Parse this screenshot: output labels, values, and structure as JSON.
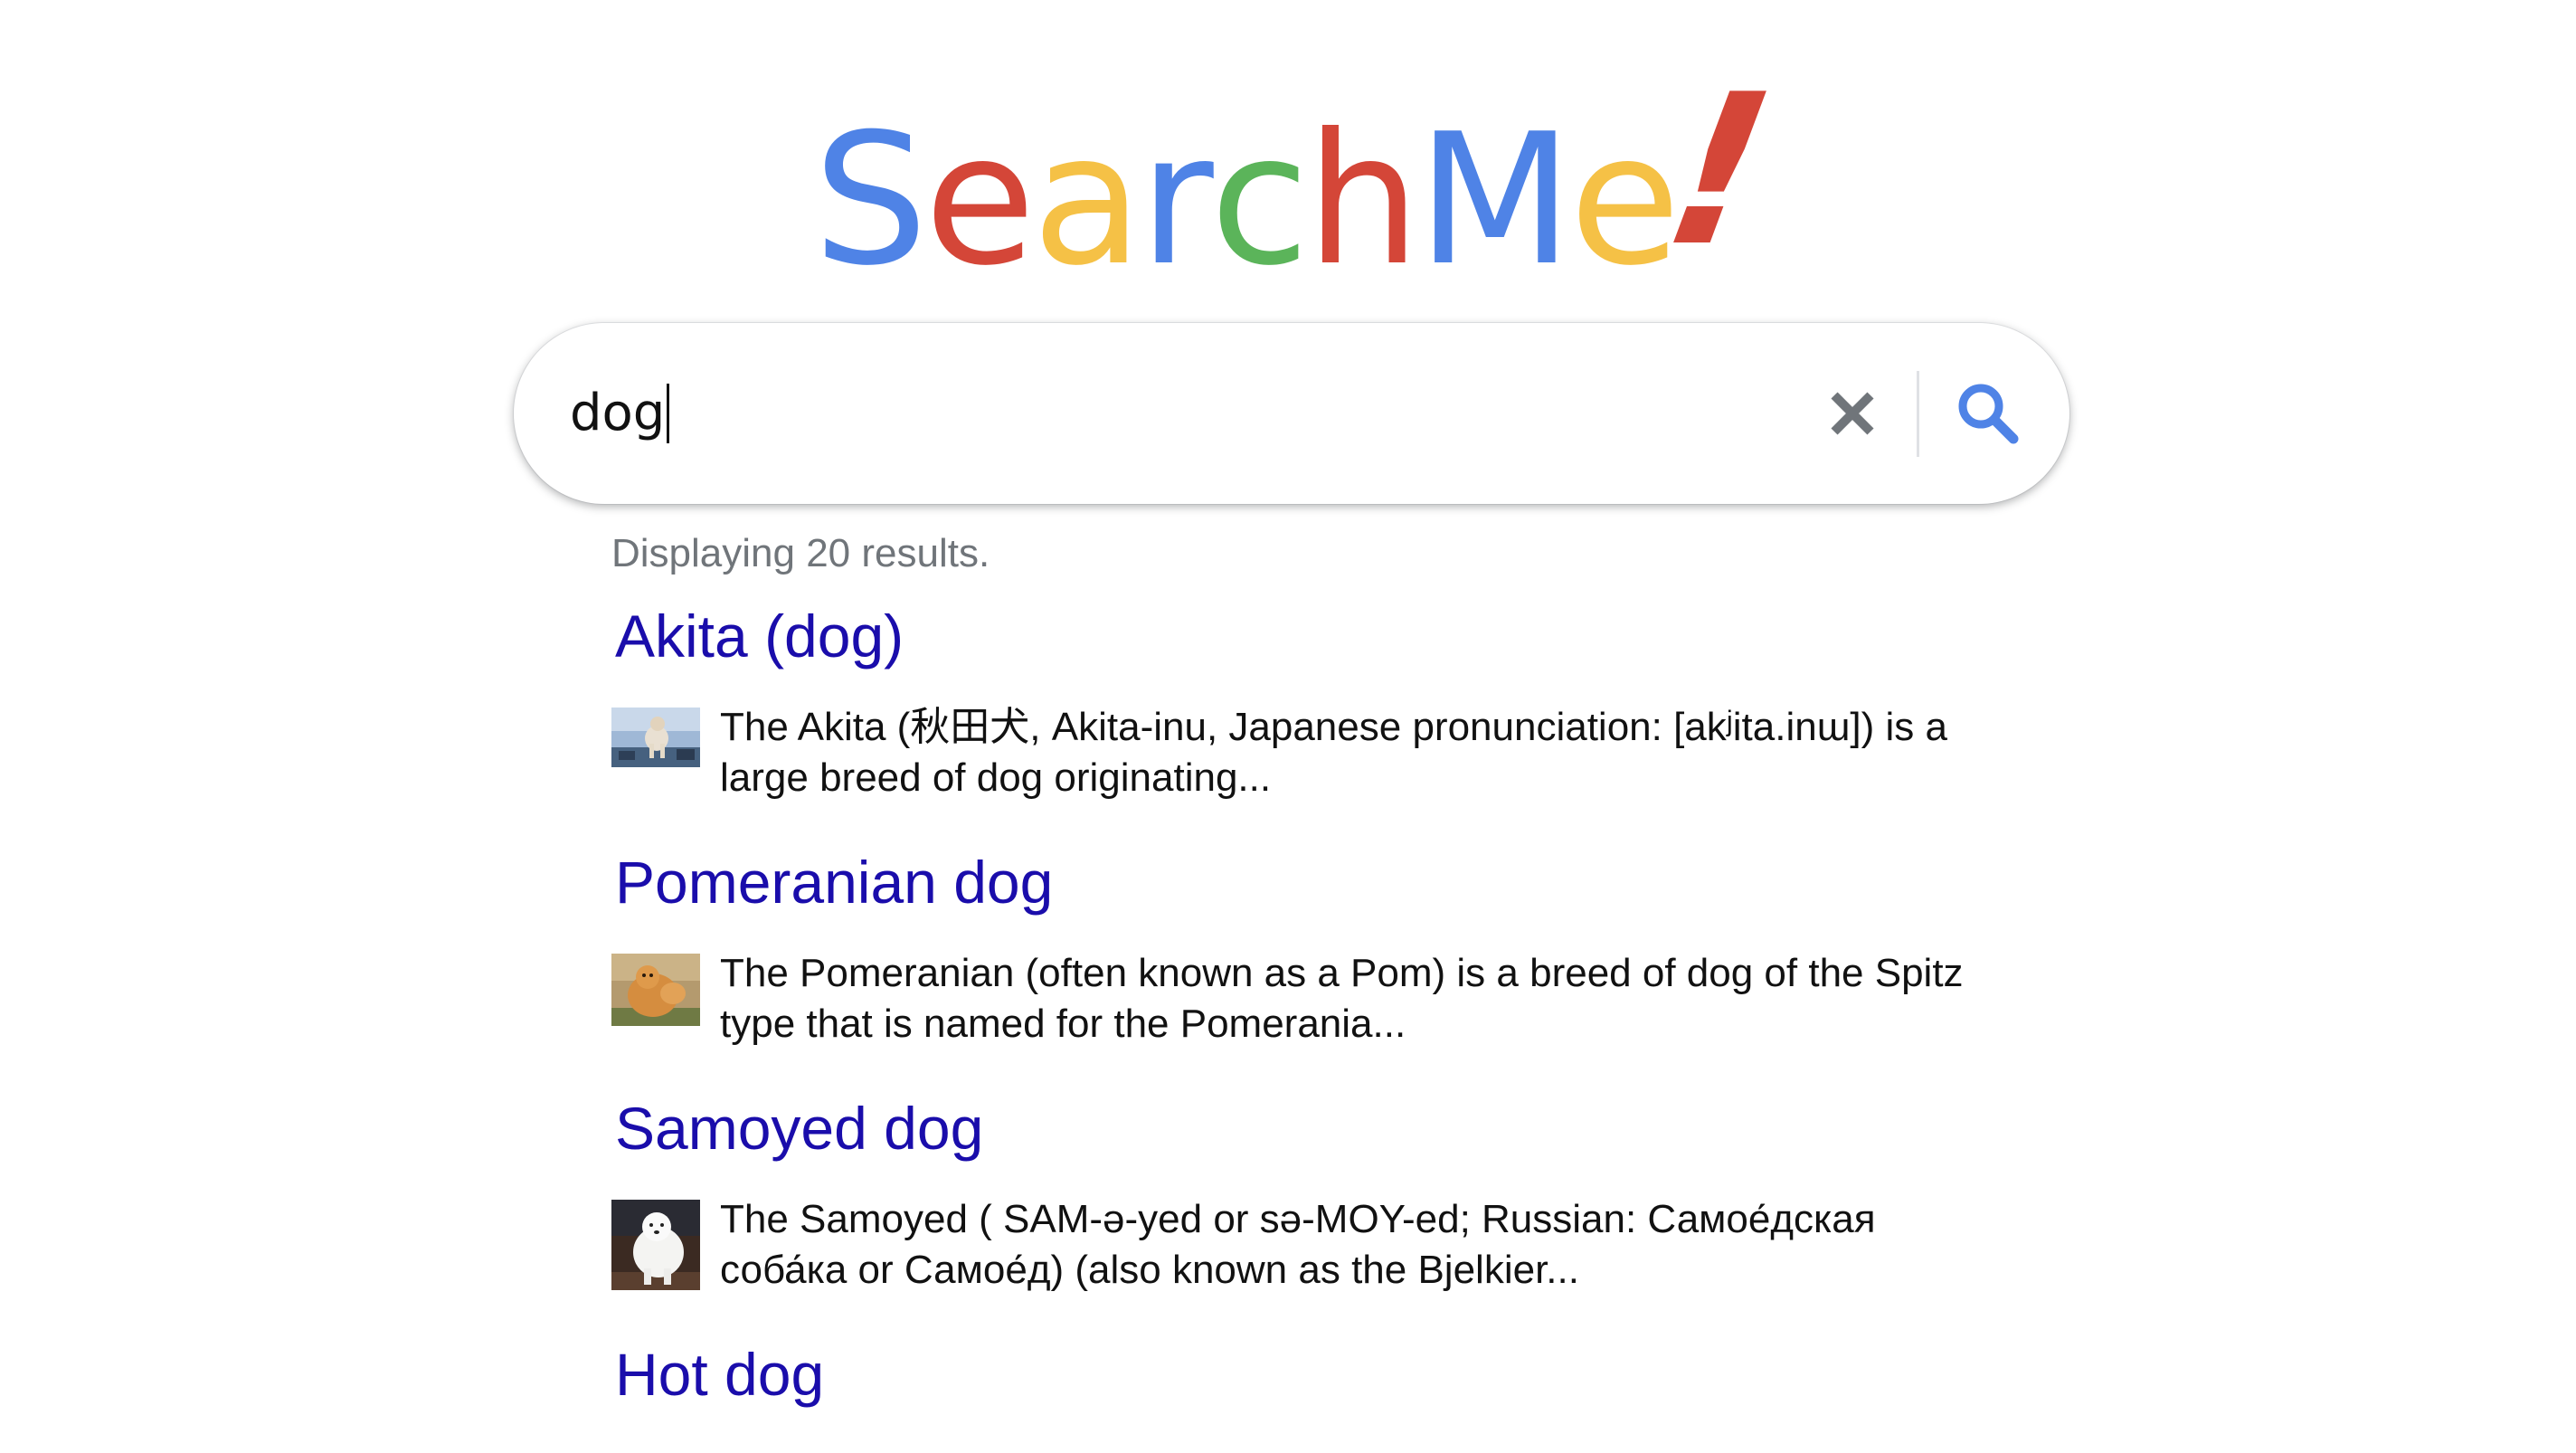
{
  "logo": {
    "letters": [
      {
        "char": "S",
        "color": "#4f83e6"
      },
      {
        "char": "e",
        "color": "#d44638"
      },
      {
        "char": "a",
        "color": "#f5c146"
      },
      {
        "char": "r",
        "color": "#4f83e6"
      },
      {
        "char": "c",
        "color": "#5bb45a"
      },
      {
        "char": "h",
        "color": "#d44638"
      },
      {
        "char": "M",
        "color": "#4f83e6"
      },
      {
        "char": "e",
        "color": "#f5c146"
      },
      {
        "char": "!",
        "color": "#d44638"
      }
    ]
  },
  "search": {
    "query": "dog",
    "clear_icon": "close-icon",
    "search_icon": "search-icon",
    "accent": "#4f83e6"
  },
  "results": {
    "count_text": "Displaying 20 results.",
    "title_color": "#1a0dab",
    "items": [
      {
        "title": "Akita (dog)",
        "snippet": "The Akita (秋田犬, Akita-inu, Japanese pronunciation: [akʲita.inɯ]) is a large breed of dog originating...",
        "thumbnail": "akita-dog-thumbnail"
      },
      {
        "title": "Pomeranian dog",
        "snippet": "The Pomeranian (often known as a Pom) is a breed of dog of the Spitz type that is named for the Pomerania...",
        "thumbnail": "pomeranian-dog-thumbnail"
      },
      {
        "title": "Samoyed dog",
        "snippet": "The Samoyed ( SAM-ə-yed or sə-MOY-ed; Russian: Самое́дская соба́ка or Самое́д) (also known as the Bjelkier...",
        "thumbnail": "samoyed-dog-thumbnail"
      },
      {
        "title": "Hot dog"
      }
    ]
  }
}
